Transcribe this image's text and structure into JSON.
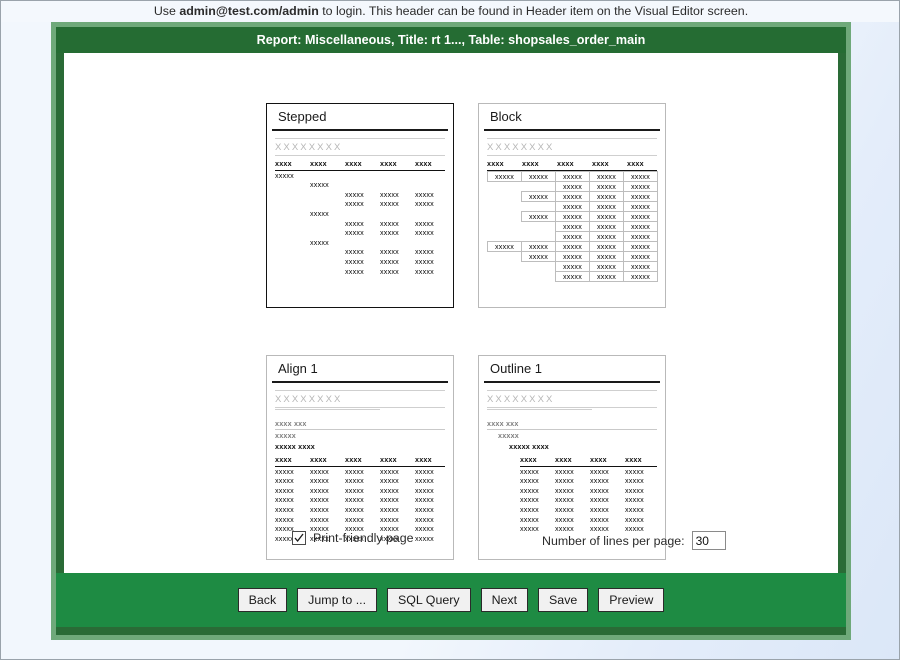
{
  "instruction": {
    "prefix": "Use ",
    "credentials": "admin@test.com/admin",
    "suffix": " to login. This header can be found in Header item on the Visual Editor screen."
  },
  "window": {
    "title": "Report: Miscellaneous, Title: rt 1..., Table: shopsales_order_main"
  },
  "colors": {
    "title_bar_green": "#256c33",
    "frame_green": "#6fa97a",
    "button_bar_green": "#1e8b43",
    "page_background": "#eef4fb",
    "selected_border": "#121212",
    "unselected_border": "#b9b9b9"
  },
  "layouts": [
    {
      "id": "stepped",
      "label": "Stepped",
      "selected": true,
      "placeholder_header": "XXXXXXXX",
      "columns": [
        "xxxx",
        "xxxx",
        "xxxx",
        "xxxx",
        "xxxx"
      ],
      "rows": [
        {
          "indent": 0,
          "cells": [
            "xxxxx"
          ]
        },
        {
          "indent": 1,
          "cells": [
            "xxxxx"
          ]
        },
        {
          "indent": 2,
          "cells": [
            "xxxxx",
            "xxxxx",
            "xxxxx"
          ]
        },
        {
          "indent": 2,
          "cells": [
            "xxxxx",
            "xxxxx",
            "xxxxx"
          ]
        },
        {
          "indent": 1,
          "cells": [
            "xxxxx"
          ]
        },
        {
          "indent": 2,
          "cells": [
            "xxxxx",
            "xxxxx",
            "xxxxx"
          ]
        },
        {
          "indent": 2,
          "cells": [
            "xxxxx",
            "xxxxx",
            "xxxxx"
          ]
        },
        {
          "indent": 1,
          "cells": [
            "xxxxx"
          ]
        },
        {
          "indent": 2,
          "cells": [
            "xxxxx",
            "xxxxx",
            "xxxxx"
          ]
        },
        {
          "indent": 2,
          "cells": [
            "xxxxx",
            "xxxxx",
            "xxxxx"
          ]
        },
        {
          "indent": 2,
          "cells": [
            "xxxxx",
            "xxxxx",
            "xxxxx"
          ]
        }
      ]
    },
    {
      "id": "block",
      "label": "Block",
      "selected": false,
      "placeholder_header": "XXXXXXXX",
      "columns": [
        "xxxx",
        "xxxx",
        "xxxx",
        "xxxx",
        "xxxx"
      ],
      "rows": [
        {
          "filled": [
            true,
            true,
            true,
            true,
            true
          ],
          "text": "xxxxx"
        },
        {
          "filled": [
            false,
            false,
            true,
            true,
            true
          ],
          "text": "xxxxx"
        },
        {
          "filled": [
            false,
            true,
            true,
            true,
            true
          ],
          "text": "xxxxx"
        },
        {
          "filled": [
            false,
            false,
            true,
            true,
            true
          ],
          "text": "xxxxx"
        },
        {
          "filled": [
            false,
            true,
            true,
            true,
            true
          ],
          "text": "xxxxx"
        },
        {
          "filled": [
            false,
            false,
            true,
            true,
            true
          ],
          "text": "xxxxx"
        },
        {
          "filled": [
            false,
            false,
            true,
            true,
            true
          ],
          "text": "xxxxx"
        },
        {
          "filled": [
            true,
            true,
            true,
            true,
            true
          ],
          "text": "xxxxx"
        },
        {
          "filled": [
            false,
            true,
            true,
            true,
            true
          ],
          "text": "xxxxx"
        },
        {
          "filled": [
            false,
            false,
            true,
            true,
            true
          ],
          "text": "xxxxx"
        },
        {
          "filled": [
            false,
            false,
            true,
            true,
            true
          ],
          "text": "xxxxx"
        }
      ]
    },
    {
      "id": "align1",
      "label": "Align 1",
      "selected": false,
      "placeholder_header": "XXXXXXXX",
      "group_lines": [
        {
          "text": "xxxx xxx",
          "style": "gray",
          "indent": 0,
          "underline": true
        },
        {
          "text": "xxxxx",
          "style": "gray",
          "indent": 0,
          "underline": false
        },
        {
          "text": "xxxxx xxxx",
          "style": "bold",
          "indent": 0,
          "underline": false
        }
      ],
      "columns": [
        "xxxx",
        "xxxx",
        "xxxx",
        "xxxx",
        "xxxx"
      ],
      "rows": [
        {
          "cells": [
            "xxxxx",
            "xxxxx",
            "xxxxx",
            "xxxxx",
            "xxxxx"
          ]
        },
        {
          "cells": [
            "xxxxx",
            "xxxxx",
            "xxxxx",
            "xxxxx",
            "xxxxx"
          ]
        },
        {
          "cells": [
            "xxxxx",
            "xxxxx",
            "xxxxx",
            "xxxxx",
            "xxxxx"
          ]
        },
        {
          "cells": [
            "xxxxx",
            "xxxxx",
            "xxxxx",
            "xxxxx",
            "xxxxx"
          ]
        },
        {
          "cells": [
            "xxxxx",
            "xxxxx",
            "xxxxx",
            "xxxxx",
            "xxxxx"
          ]
        },
        {
          "cells": [
            "xxxxx",
            "xxxxx",
            "xxxxx",
            "xxxxx",
            "xxxxx"
          ]
        },
        {
          "cells": [
            "xxxxx",
            "xxxxx",
            "xxxxx",
            "xxxxx",
            "xxxxx"
          ]
        },
        {
          "cells": [
            "xxxxx",
            "xxxxx",
            "xxxxx",
            "xxxxx",
            "xxxxx"
          ]
        }
      ]
    },
    {
      "id": "outline1",
      "label": "Outline 1",
      "selected": false,
      "placeholder_header": "XXXXXXXX",
      "group_lines": [
        {
          "text": "xxxx xxx",
          "style": "gray",
          "indent": 0,
          "underline": true
        },
        {
          "text": "xxxxx",
          "style": "gray",
          "indent": 1,
          "underline": false
        },
        {
          "text": "xxxxx xxxx",
          "style": "bold",
          "indent": 2,
          "underline": false
        }
      ],
      "columns": [
        "xxxx",
        "xxxx",
        "xxxx",
        "xxxx"
      ],
      "rows": [
        {
          "cells": [
            "xxxxx",
            "xxxxx",
            "xxxxx",
            "xxxxx"
          ]
        },
        {
          "cells": [
            "xxxxx",
            "xxxxx",
            "xxxxx",
            "xxxxx"
          ]
        },
        {
          "cells": [
            "xxxxx",
            "xxxxx",
            "xxxxx",
            "xxxxx"
          ]
        },
        {
          "cells": [
            "xxxxx",
            "xxxxx",
            "xxxxx",
            "xxxxx"
          ]
        },
        {
          "cells": [
            "xxxxx",
            "xxxxx",
            "xxxxx",
            "xxxxx"
          ]
        },
        {
          "cells": [
            "xxxxx",
            "xxxxx",
            "xxxxx",
            "xxxxx"
          ]
        },
        {
          "cells": [
            "xxxxx",
            "xxxxx",
            "xxxxx",
            "xxxxx"
          ]
        }
      ]
    }
  ],
  "options": {
    "print_friendly_label": "Print-friendly page",
    "print_friendly_checked": true,
    "lines_label": "Number of lines per page:",
    "lines_value": "30"
  },
  "buttons": [
    {
      "id": "back",
      "label": "Back"
    },
    {
      "id": "jump-to",
      "label": "Jump to ..."
    },
    {
      "id": "sql-query",
      "label": "SQL Query"
    },
    {
      "id": "next",
      "label": "Next"
    },
    {
      "id": "save",
      "label": "Save"
    },
    {
      "id": "preview",
      "label": "Preview"
    }
  ]
}
